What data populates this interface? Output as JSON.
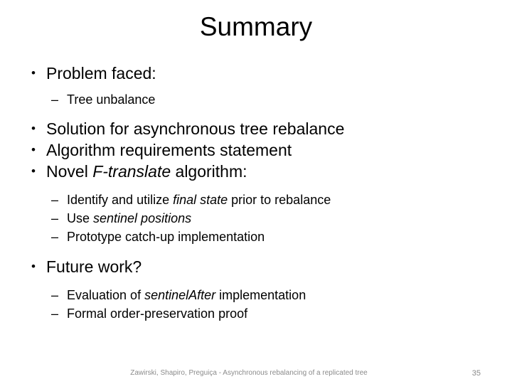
{
  "slide": {
    "title": "Summary",
    "bullet_glyph": "•",
    "dash_glyph": "–",
    "text_color": "#000000",
    "background_color": "#ffffff",
    "footer_color": "#8b8b8b"
  },
  "content": {
    "b1": {
      "text": "Problem faced:"
    },
    "b1s1": {
      "text": "Tree unbalance"
    },
    "b2": {
      "text": "Solution for asynchronous tree rebalance"
    },
    "b3": {
      "text": "Algorithm requirements statement"
    },
    "b4": {
      "pre": "Novel ",
      "em": "F-translate",
      "post": " algorithm:"
    },
    "b4s1": {
      "pre": "Identify and utilize ",
      "em": "final state",
      "post": " prior to rebalance"
    },
    "b4s2": {
      "pre": "Use ",
      "em": "sentinel positions",
      "post": ""
    },
    "b4s3": {
      "text": "Prototype catch-up implementation"
    },
    "b5": {
      "text": "Future work?"
    },
    "b5s1": {
      "pre": "Evaluation of ",
      "em": "sentinelAfter",
      "post": " implementation"
    },
    "b5s2": {
      "text": "Formal order-preservation proof"
    }
  },
  "footer": {
    "citation": "Zawirski, Shapiro, Preguiça - Asynchronous rebalancing of a replicated tree",
    "page_number": "35"
  }
}
